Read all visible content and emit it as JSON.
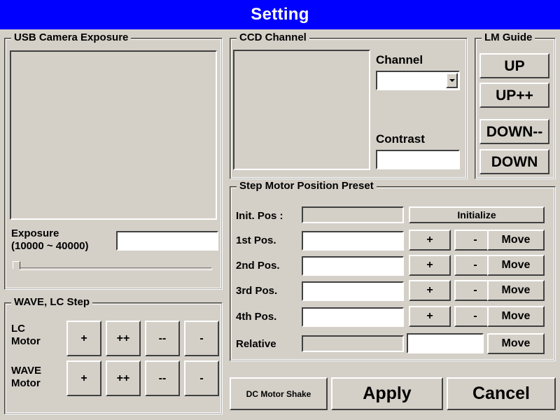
{
  "window": {
    "title": "Setting"
  },
  "usb_camera_exposure": {
    "group_title": "USB Camera Exposure",
    "preview_alt": "camera-preview",
    "exposure_label": "Exposure\n(10000 ~ 40000)",
    "exposure_value": "",
    "exposure_placeholder": "",
    "slider_value": 0,
    "slider_min": 10000,
    "slider_max": 40000
  },
  "wave_lc_step": {
    "group_title": "WAVE, LC Step",
    "rows": [
      {
        "label": "LC\nMotor",
        "buttons": [
          "+",
          "++",
          "--",
          "-"
        ]
      },
      {
        "label": "WAVE\nMotor",
        "buttons": [
          "+",
          "++",
          "--",
          "-"
        ]
      }
    ]
  },
  "ccd_channel": {
    "group_title": "CCD Channel",
    "preview_alt": "ccd-preview",
    "channel_label": "Channel",
    "channel_value": "",
    "channel_options": [],
    "contrast_label": "Contrast",
    "contrast_value": ""
  },
  "lm_guide": {
    "group_title": "LM Guide",
    "buttons": [
      "UP",
      "UP++",
      "DOWN--",
      "DOWN"
    ]
  },
  "step_motor": {
    "group_title": "Step Motor Position Preset",
    "init_row": {
      "label": "Init. Pos :",
      "value": "",
      "disabled": true,
      "action": "Initialize"
    },
    "rows": [
      {
        "label": "1st Pos.",
        "value": "",
        "plus": "+",
        "minus": "-",
        "move": "Move"
      },
      {
        "label": "2nd Pos.",
        "value": "",
        "plus": "+",
        "minus": "-",
        "move": "Move"
      },
      {
        "label": "3rd Pos.",
        "value": "",
        "plus": "+",
        "minus": "-",
        "move": "Move"
      },
      {
        "label": "4th Pos.",
        "value": "",
        "plus": "+",
        "minus": "-",
        "move": "Move"
      }
    ],
    "relative_row": {
      "label": "Relative",
      "readout_value": "",
      "input_value": "",
      "move": "Move"
    }
  },
  "footer": {
    "dc_motor_shake": "DC Motor Shake",
    "apply": "Apply",
    "cancel": "Cancel"
  },
  "colors": {
    "titlebar_bg": "#0000ff",
    "titlebar_fg": "#ffffff",
    "dialog_bg": "#d4d0c8",
    "field_bg": "#ffffff",
    "shadow": "#404040",
    "highlight": "#ffffff"
  }
}
